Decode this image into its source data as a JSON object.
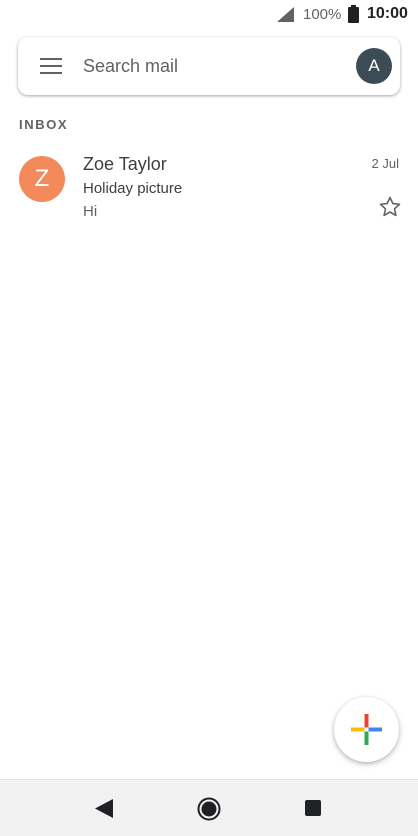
{
  "status_bar": {
    "battery_percent": "100%",
    "time": "10:00",
    "icons": [
      "signal-icon",
      "battery-icon"
    ]
  },
  "search": {
    "placeholder": "Search mail",
    "account_initial": "A",
    "icons": [
      "menu-icon"
    ]
  },
  "section_label": "INBOX",
  "emails": [
    {
      "sender_initial": "Z",
      "sender": "Zoe Taylor",
      "date": "2 Jul",
      "subject": "Holiday picture",
      "snippet": "Hi",
      "starred": false
    }
  ],
  "fab": {
    "icon": "compose-plus-icon"
  },
  "nav_bar": {
    "icons": [
      "back-icon",
      "home-icon",
      "recents-icon"
    ]
  },
  "colors": {
    "sender_avatar": "#f28a5c",
    "account_avatar": "#3c4c57",
    "fab_plus": [
      "#4285f4",
      "#ea4335",
      "#fbbc05",
      "#34a853"
    ]
  }
}
